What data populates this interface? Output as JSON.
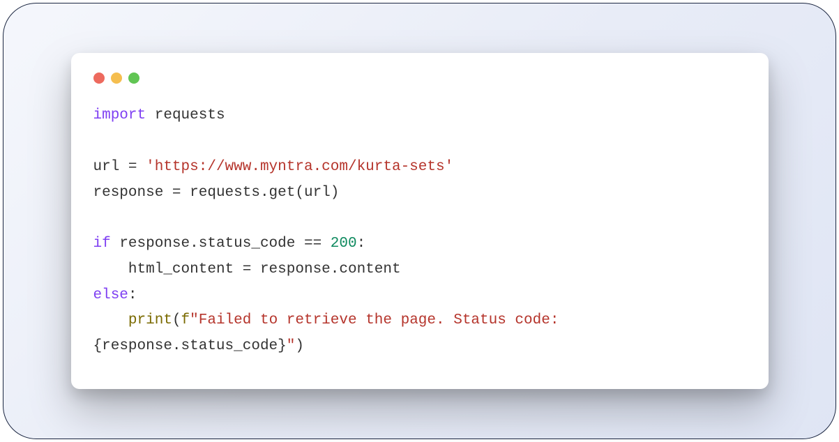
{
  "code": {
    "line1": {
      "import": "import",
      "module": "requests"
    },
    "line2": {
      "var": "url",
      "eq": " = ",
      "str": "'https://www.myntra.com/kurta-sets'"
    },
    "line3": {
      "var": "response",
      "eq": " = ",
      "call": "requests.get(url)"
    },
    "line4": {
      "kw": "if",
      "cond_left": " response.status_code ",
      "op": "==",
      "sp": " ",
      "num": "200",
      "colon": ":"
    },
    "line5": {
      "indent": "    ",
      "assign": "html_content = response.content"
    },
    "line6": {
      "kw": "else",
      "colon": ":"
    },
    "line7": {
      "indent": "    ",
      "print": "print",
      "open": "(",
      "fprefix": "f",
      "str1": "\"Failed to retrieve the page. Status code: ",
      "brace_open": "{",
      "expr_cont": "response.status_code",
      "brace_close": "}",
      "str2": "\"",
      "close": ")"
    }
  }
}
